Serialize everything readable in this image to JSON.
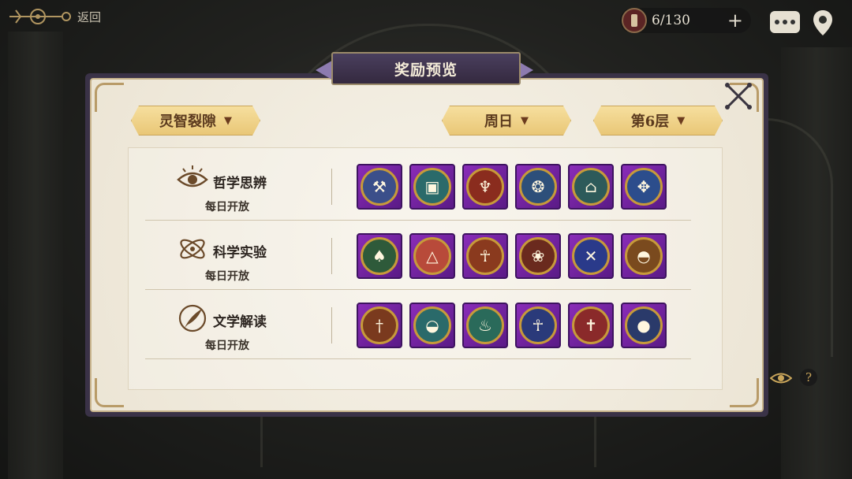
{
  "top_bar": {
    "back_label": "返回",
    "resource_count": "6/130",
    "plus_label": "+"
  },
  "panel": {
    "title": "奖励预览",
    "dropdowns": [
      {
        "label": "灵智裂隙"
      },
      {
        "label": "周日"
      },
      {
        "label": "第6层"
      }
    ]
  },
  "rows": [
    {
      "name": "哲学思辨",
      "open_label": "每日开放",
      "icon": "eye-icon",
      "items": [
        {
          "icon": "axe-icon",
          "color": "#3b4f8a"
        },
        {
          "icon": "chest-icon",
          "color": "#6b5a2e"
        },
        {
          "icon": "goblet-icon",
          "color": "#8a2c1e"
        },
        {
          "icon": "scarab-icon",
          "color": "#2d4f7a"
        },
        {
          "icon": "shrine-icon",
          "color": "#2d5a5a"
        },
        {
          "icon": "tablet-icon",
          "color": "#2c4d8c"
        }
      ]
    },
    {
      "name": "科学实验",
      "open_label": "每日开放",
      "icon": "atom-icon",
      "items": [
        {
          "icon": "spearhead-icon",
          "color": "#2e5a3a"
        },
        {
          "icon": "pyramid-eye-icon",
          "color": "#b84a3a"
        },
        {
          "icon": "mask-icon",
          "color": "#8a3a1e"
        },
        {
          "icon": "laurel-icon",
          "color": "#6a2a1e"
        },
        {
          "icon": "daggers-icon",
          "color": "#2a3a8a"
        },
        {
          "icon": "helmet-icon",
          "color": "#7a4a1e"
        }
      ]
    },
    {
      "name": "文学解读",
      "open_label": "每日开放",
      "icon": "quill-icon",
      "items": [
        {
          "icon": "sword-icon",
          "color": "#7a3a1e"
        },
        {
          "icon": "helm-icon",
          "color": "#2a6a6a"
        },
        {
          "icon": "lamp-icon",
          "color": "#2a6a5a"
        },
        {
          "icon": "ankh-icon",
          "color": "#2a3a7a"
        },
        {
          "icon": "dagger-icon",
          "color": "#8a2a2a"
        },
        {
          "icon": "crystal-ball-icon",
          "color": "#2a3a6a"
        }
      ]
    }
  ],
  "help_label": "?"
}
